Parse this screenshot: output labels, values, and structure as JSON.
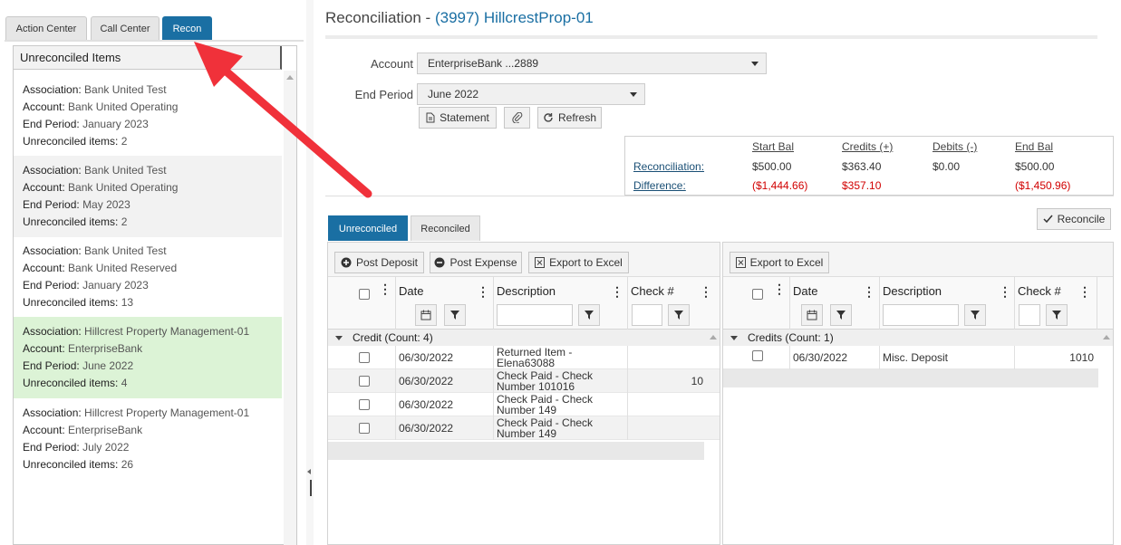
{
  "left_tabs": [
    {
      "label": "Action Center",
      "active": false
    },
    {
      "label": "Call Center",
      "active": false
    },
    {
      "label": "Recon",
      "active": true
    }
  ],
  "unreconciled": {
    "header": "Unreconciled Items",
    "field_labels": {
      "association": "Association:",
      "account": "Account:",
      "end_period": "End Period:",
      "items": "Unreconciled items:"
    },
    "cards": [
      {
        "association": "Bank United Test",
        "account": "Bank United Operating",
        "end_period": "January 2023",
        "items": "2"
      },
      {
        "association": "Bank United Test",
        "account": "Bank United Operating",
        "end_period": "May 2023",
        "items": "2"
      },
      {
        "association": "Bank United Test",
        "account": "Bank United Reserved",
        "end_period": "January 2023",
        "items": "13"
      },
      {
        "association": "Hillcrest Property Management-01",
        "account": "EnterpriseBank",
        "end_period": "June 2022",
        "items": "4"
      },
      {
        "association": "Hillcrest Property Management-01",
        "account": "EnterpriseBank",
        "end_period": "July 2022",
        "items": "26"
      }
    ]
  },
  "page": {
    "title_prefix": "Reconciliation - ",
    "title_property": "(3997) HillcrestProp-01"
  },
  "form": {
    "account_label": "Account",
    "account_value": "EnterpriseBank ...2889",
    "end_period_label": "End Period",
    "end_period_value": "June 2022"
  },
  "actions": {
    "statement": "Statement",
    "refresh": "Refresh",
    "reconcile": "Reconcile"
  },
  "summary": {
    "headers": {
      "start": "Start Bal",
      "credits": "Credits (+)",
      "debits": "Debits (-)",
      "end": "End Bal"
    },
    "reconciliation": {
      "label": "Reconciliation:",
      "start": "$500.00",
      "credits": "$363.40",
      "debits": "$0.00",
      "end": "$500.00"
    },
    "difference": {
      "label": "Difference:",
      "start": "($1,444.66)",
      "credits": "$357.10",
      "end": "($1,450.96)"
    }
  },
  "grid_tabs": [
    {
      "label": "Unreconciled",
      "active": true
    },
    {
      "label": "Reconciled",
      "active": false
    }
  ],
  "left_grid": {
    "buttons": {
      "post_deposit": "Post Deposit",
      "post_expense": "Post Expense",
      "export": "Export to Excel"
    },
    "columns": {
      "date": "Date",
      "description": "Description",
      "check": "Check #"
    },
    "group": "Credit (Count: 4)",
    "rows": [
      {
        "date": "06/30/2022",
        "desc1": "Returned Item -",
        "desc2": "Elena63088",
        "check": ""
      },
      {
        "date": "06/30/2022",
        "desc1": "Check Paid - Check",
        "desc2": "Number 101016",
        "check": "10"
      },
      {
        "date": "06/30/2022",
        "desc1": "Check Paid - Check",
        "desc2": "Number 149",
        "check": ""
      },
      {
        "date": "06/30/2022",
        "desc1": "Check Paid - Check",
        "desc2": "Number 149",
        "check": ""
      }
    ]
  },
  "right_grid": {
    "buttons": {
      "export": "Export to Excel"
    },
    "columns": {
      "date": "Date",
      "description": "Description",
      "check": "Check #"
    },
    "group": "Credits (Count: 1)",
    "rows": [
      {
        "date": "06/30/2022",
        "desc": "Misc. Deposit",
        "check": "1010"
      }
    ]
  },
  "colors": {
    "accent": "#1a6fa3",
    "selected_row": "#dcf3d6",
    "negative": "#d10000",
    "annotation_arrow": "#f0313a"
  },
  "icons": {
    "statement": "document-icon",
    "attach": "paperclip-icon",
    "refresh": "refresh-icon",
    "reconcile": "checkmark-icon",
    "post_deposit": "plus-circle-icon",
    "post_expense": "minus-circle-icon",
    "export": "excel-icon",
    "calendar": "calendar-icon",
    "filter": "filter-icon"
  }
}
